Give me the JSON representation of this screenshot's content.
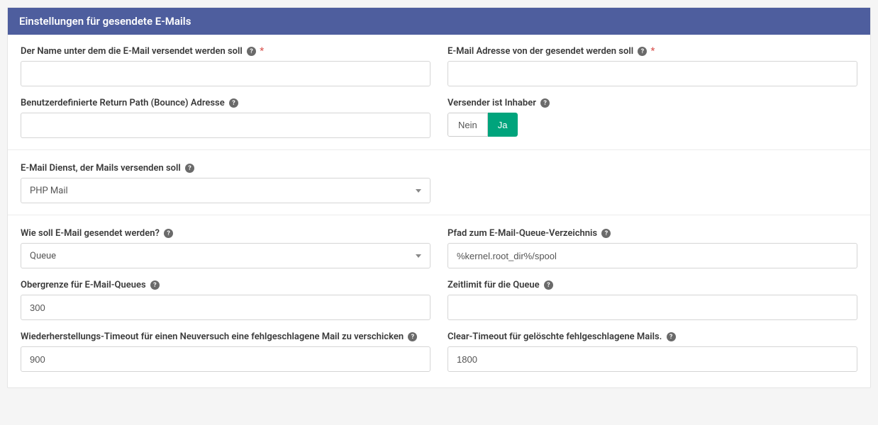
{
  "panel": {
    "title": "Einstellungen für gesendete E-Mails"
  },
  "fields": {
    "from_name": {
      "label": "Der Name unter dem die E-Mail versendet werden soll",
      "value": "",
      "required": true
    },
    "from_email": {
      "label": "E-Mail Adresse von der gesendet werden soll",
      "value": "",
      "required": true
    },
    "return_path": {
      "label": "Benutzerdefinierte Return Path (Bounce) Adresse",
      "value": ""
    },
    "is_owner": {
      "label": "Versender ist Inhaber",
      "no": "Nein",
      "yes": "Ja",
      "value": "Ja"
    },
    "mailer": {
      "label": "E-Mail Dienst, der Mails versenden soll",
      "value": "PHP Mail"
    },
    "send_mode": {
      "label": "Wie soll E-Mail gesendet werden?",
      "value": "Queue"
    },
    "queue_path": {
      "label": "Pfad zum E-Mail-Queue-Verzeichnis",
      "value": "%kernel.root_dir%/spool"
    },
    "queue_limit": {
      "label": "Obergrenze für E-Mail-Queues",
      "value": "300"
    },
    "queue_time": {
      "label": "Zeitlimit für die Queue",
      "value": ""
    },
    "recover_timeout": {
      "label": "Wiederherstellungs-Timeout für einen Neuversuch eine fehlgeschlagene Mail zu verschicken",
      "value": "900"
    },
    "clear_timeout": {
      "label": "Clear-Timeout für gelöschte fehlgeschlagene Mails.",
      "value": "1800"
    }
  }
}
